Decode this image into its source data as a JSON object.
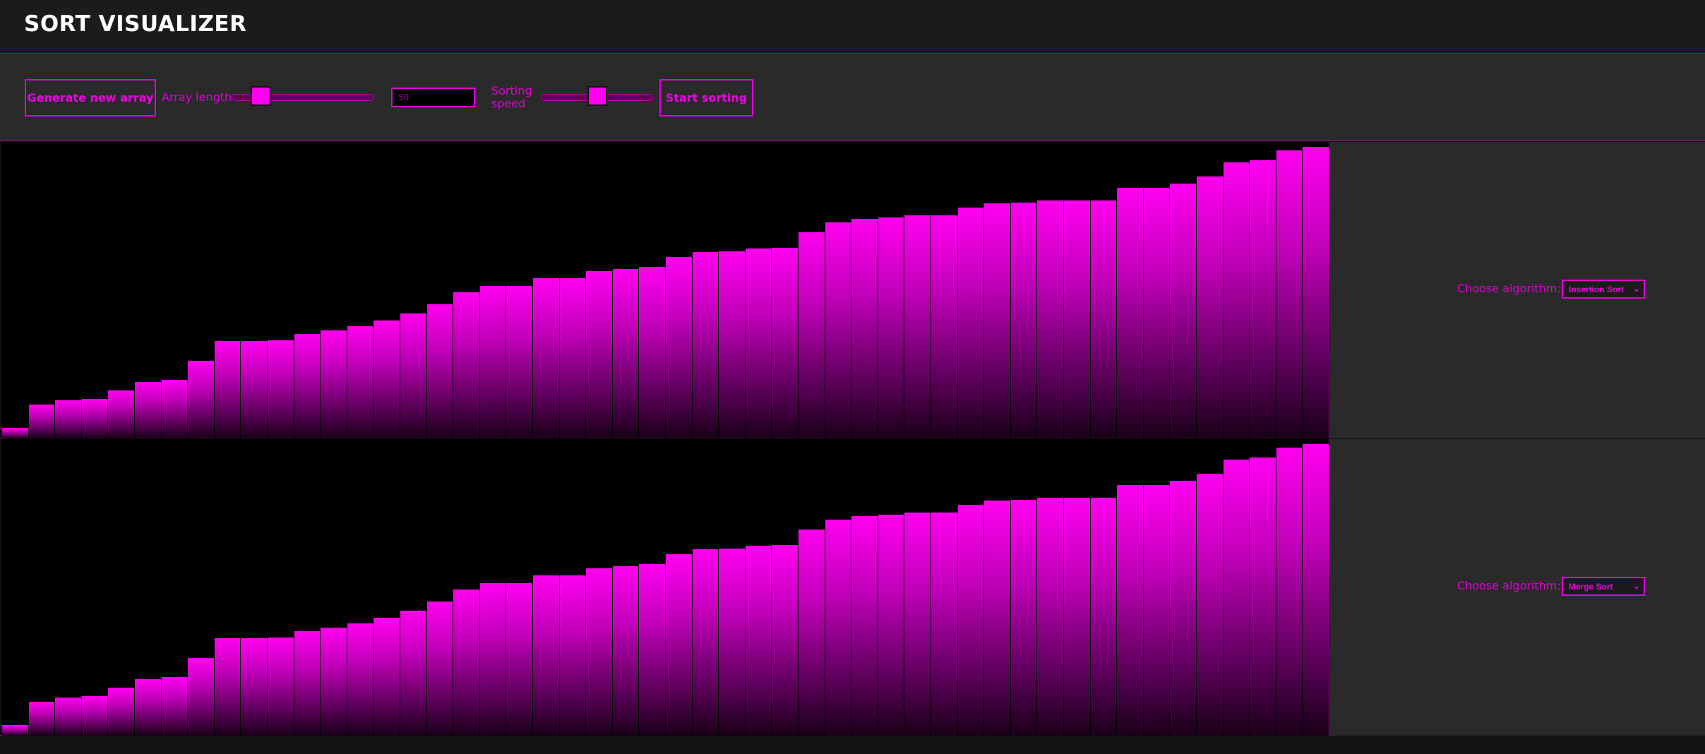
{
  "app": {
    "title": "SORT VISUALIZER"
  },
  "controls": {
    "generate_label": "Generate new array",
    "length_label": "Array length",
    "length_value": "50",
    "length_slider_level": 0.15,
    "speed_label": "Sorting speed",
    "speed_slider_level": 0.5,
    "start_label": "Start sorting"
  },
  "colors": {
    "accent": "#f000e6",
    "background": "#000000",
    "panel": "#2a2a2a"
  },
  "panels": [
    {
      "choose_label": "Choose algorithm:",
      "algorithm": "Insertion Sort"
    },
    {
      "choose_label": "Choose algorithm:",
      "algorithm": "Merge Sort"
    }
  ],
  "array_values": [
    14,
    46,
    51,
    53,
    65,
    76,
    79,
    105,
    131,
    131,
    132,
    141,
    146,
    151,
    159,
    169,
    181,
    197,
    206,
    206,
    216,
    216,
    226,
    229,
    231,
    245,
    251,
    252,
    256,
    257,
    278,
    291,
    296,
    298,
    301,
    301,
    311,
    317,
    318,
    321,
    321,
    321,
    338,
    338,
    344,
    353,
    372,
    375,
    389,
    393
  ],
  "array_max": 400
}
